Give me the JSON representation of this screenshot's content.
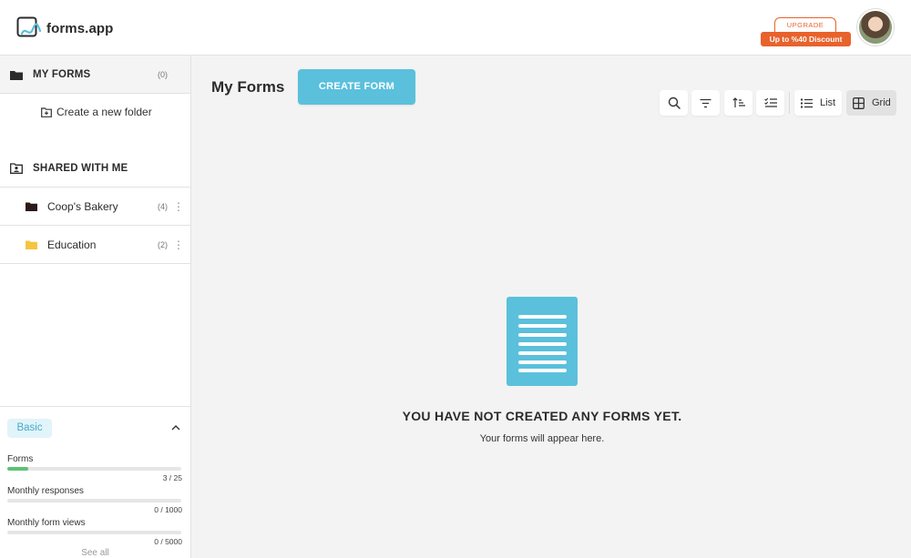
{
  "header": {
    "logo_text": "forms.app",
    "upgrade_top": "UPGRADE",
    "upgrade_band": "Up to %40 Discount"
  },
  "sidebar": {
    "my_forms": {
      "label": "MY FORMS",
      "count": "(0)"
    },
    "new_folder_label": "Create a new folder",
    "shared": {
      "label": "SHARED WITH ME"
    },
    "folders": [
      {
        "label": "Coop's Bakery",
        "count": "(4)",
        "color": "#2b1a1a"
      },
      {
        "label": "Education",
        "count": "(2)",
        "color": "#f5c542"
      }
    ],
    "usage": {
      "plan": "Basic",
      "metrics": [
        {
          "label": "Forms",
          "value": "3 / 25",
          "fraction": 0.12
        },
        {
          "label": "Monthly responses",
          "value": "0 / 1000",
          "fraction": 0
        },
        {
          "label": "Monthly form views",
          "value": "0 / 5000",
          "fraction": 0
        }
      ],
      "see_all": "See all"
    }
  },
  "main": {
    "title": "My Forms",
    "create_button": "CREATE FORM",
    "toolbar": {
      "icons": [
        "search-icon",
        "filter-icon",
        "sort-icon",
        "select-icon"
      ],
      "list_label": "List",
      "grid_label": "Grid",
      "active_view": "Grid"
    },
    "empty": {
      "title": "YOU HAVE NOT CREATED ANY FORMS YET.",
      "subtitle": "Your forms will appear here."
    }
  },
  "colors": {
    "accent": "#5ac0dc",
    "upgrade": "#e8622c",
    "progress": "#5cc275",
    "plan_badge_bg": "#e1f4f9"
  }
}
